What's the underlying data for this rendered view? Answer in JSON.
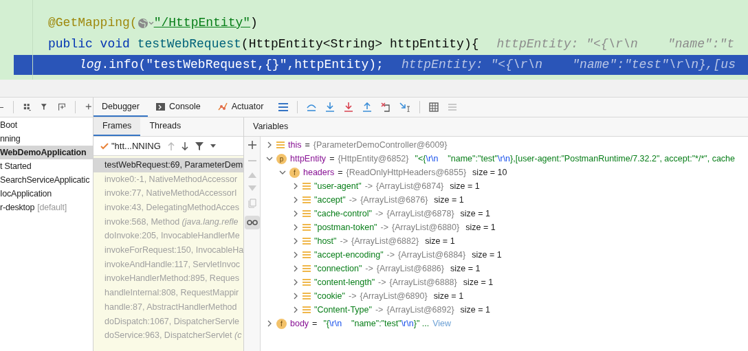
{
  "editor": {
    "lines": [
      {
        "current": false,
        "tokens": [
          {
            "kind": "annotation",
            "text": "@GetMapping("
          },
          {
            "kind": "globe"
          },
          {
            "kind": "string",
            "text": "\"/HttpEntity\""
          },
          {
            "kind": "plain",
            "text": ")"
          }
        ]
      },
      {
        "current": false,
        "tokens": [
          {
            "kind": "keyword",
            "text": "public void "
          },
          {
            "kind": "method",
            "text": "testWebRequest"
          },
          {
            "kind": "plain",
            "text": "(HttpEntity<String> httpEntity){"
          },
          {
            "kind": "hint",
            "text": "httpEntity: \"<{\\r\\n    \"name\":\"t"
          }
        ]
      },
      {
        "current": true,
        "tokens": [
          {
            "kind": "italic",
            "text": "log"
          },
          {
            "kind": "plain",
            "text": ".info(\"testWebRequest,{}\",httpEntity);"
          },
          {
            "kind": "hint",
            "text": "httpEntity: \"<{\\r\\n    \"name\":\"test\"\\r\\n},[us"
          }
        ]
      }
    ]
  },
  "services": {
    "items": [
      {
        "label": "Boot",
        "selected": false
      },
      {
        "label": "nning",
        "selected": false
      },
      {
        "label": "WebDemoApplication",
        "selected": true
      },
      {
        "label": "t Started",
        "selected": false
      },
      {
        "label": "SearchServiceApplicatic",
        "selected": false
      },
      {
        "label": "IocApplication",
        "selected": false
      },
      {
        "label": "r-desktop",
        "suffix": "[default]",
        "selected": false
      }
    ]
  },
  "tabs": [
    {
      "label": "Debugger",
      "selected": true
    },
    {
      "label": "Console",
      "selected": false
    },
    {
      "label": "Actuator",
      "selected": false
    }
  ],
  "frames": {
    "tabs": [
      {
        "label": "Frames",
        "selected": true
      },
      {
        "label": "Threads",
        "selected": false
      }
    ],
    "thread": "\"htt...NNING",
    "items": [
      {
        "text": "testWebRequest:69, ParameterDem",
        "selected": true
      },
      {
        "text": "invoke0:-1, NativeMethodAccessor",
        "selected": false
      },
      {
        "text": "invoke:77, NativeMethodAccessorI",
        "selected": false
      },
      {
        "text": "invoke:43, DelegatingMethodAcces",
        "selected": false
      },
      {
        "text": "invoke:568, Method *(java.lang.refle*",
        "selected": false
      },
      {
        "text": "doInvoke:205, InvocableHandlerMe",
        "selected": false
      },
      {
        "text": "invokeForRequest:150, InvocableHa",
        "selected": false
      },
      {
        "text": "invokeAndHandle:117, ServletInvoc",
        "selected": false
      },
      {
        "text": "invokeHandlerMethod:895, Reques",
        "selected": false
      },
      {
        "text": "handleInternal:808, RequestMappir",
        "selected": false
      },
      {
        "text": "handle:87, AbstractHandlerMethod",
        "selected": false
      },
      {
        "text": "doDispatch:1067, DispatcherServle",
        "selected": false
      },
      {
        "text": "doService:963, DispatcherServlet *(c*",
        "selected": false
      }
    ]
  },
  "variables": {
    "title": "Variables",
    "items": [
      {
        "kind": "object",
        "name": "this",
        "ref": "{ParameterDemoController@6009}",
        "op": "=",
        "expanded": false
      },
      {
        "kind": "param",
        "badge": "p",
        "name": "httpEntity",
        "ref": "{HttpEntity@6852}",
        "op": "=",
        "expanded": true,
        "value": [
          {
            "kind": "text",
            "text": "\"<{"
          },
          {
            "kind": "escape",
            "text": "\\r\\n"
          },
          {
            "kind": "text",
            "text": "    \"name\":\"test\""
          },
          {
            "kind": "escape",
            "text": "\\r\\n"
          },
          {
            "kind": "text",
            "text": "},[user-agent:\"PostmanRuntime/7.32.2\", accept:\"*/*\", cache"
          }
        ],
        "children": [
          {
            "kind": "field",
            "badge": "f",
            "name": "headers",
            "ref": "{ReadOnlyHttpHeaders@6855}",
            "op": "=",
            "size": "size = 10",
            "expanded": true,
            "children": [
              {
                "kind": "entry",
                "key": "\"user-agent\"",
                "op": "->",
                "ref": "{ArrayList@6874}",
                "size": "size = 1",
                "expanded": false
              },
              {
                "kind": "entry",
                "key": "\"accept\"",
                "op": "->",
                "ref": "{ArrayList@6876}",
                "size": "size = 1",
                "expanded": false
              },
              {
                "kind": "entry",
                "key": "\"cache-control\"",
                "op": "->",
                "ref": "{ArrayList@6878}",
                "size": "size = 1",
                "expanded": false
              },
              {
                "kind": "entry",
                "key": "\"postman-token\"",
                "op": "->",
                "ref": "{ArrayList@6880}",
                "size": "size = 1",
                "expanded": false
              },
              {
                "kind": "entry",
                "key": "\"host\"",
                "op": "->",
                "ref": "{ArrayList@6882}",
                "size": "size = 1",
                "expanded": false
              },
              {
                "kind": "entry",
                "key": "\"accept-encoding\"",
                "op": "->",
                "ref": "{ArrayList@6884}",
                "size": "size = 1",
                "expanded": false
              },
              {
                "kind": "entry",
                "key": "\"connection\"",
                "op": "->",
                "ref": "{ArrayList@6886}",
                "size": "size = 1",
                "expanded": false
              },
              {
                "kind": "entry",
                "key": "\"content-length\"",
                "op": "->",
                "ref": "{ArrayList@6888}",
                "size": "size = 1",
                "expanded": false
              },
              {
                "kind": "entry",
                "key": "\"cookie\"",
                "op": "->",
                "ref": "{ArrayList@6890}",
                "size": "size = 1",
                "expanded": false
              },
              {
                "kind": "entry",
                "key": "\"Content-Type\"",
                "op": "->",
                "ref": "{ArrayList@6892}",
                "size": "size = 1",
                "expanded": false
              }
            ]
          }
        ]
      },
      {
        "kind": "field",
        "badge": "f",
        "name": "body",
        "expanded": false,
        "value": [
          {
            "kind": "text",
            "text": "\"{"
          },
          {
            "kind": "escape",
            "text": "\\r\\n"
          },
          {
            "kind": "text",
            "text": "    \"name\":\"test\""
          },
          {
            "kind": "escape",
            "text": "\\r\\n"
          },
          {
            "kind": "text",
            "text": "}\" ..."
          }
        ],
        "link": "View",
        "op": "="
      }
    ]
  }
}
